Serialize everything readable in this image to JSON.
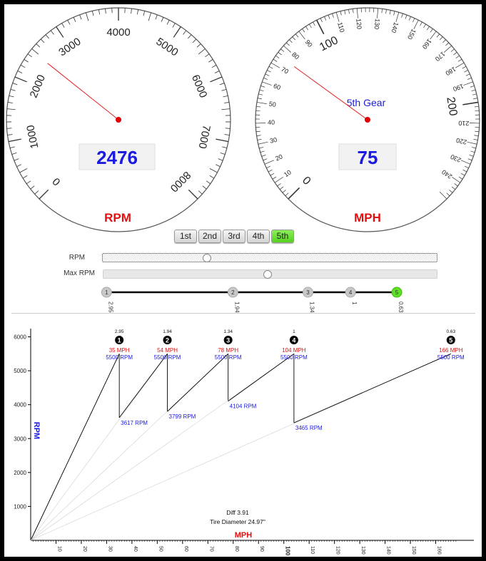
{
  "rpm_gauge": {
    "value": 2476,
    "max": 8000,
    "ticks": [
      "0",
      "1000",
      "2000",
      "3000",
      "4000",
      "5000",
      "6000",
      "7000",
      "8000"
    ],
    "label": "RPM"
  },
  "mph_gauge": {
    "value": 75,
    "max": 250,
    "gear_text": "5th Gear",
    "label": "MPH",
    "major_ticks": [
      "0",
      "100",
      "200"
    ],
    "minor_ticks": [
      "10",
      "20",
      "30",
      "40",
      "50",
      "60",
      "70",
      "80",
      "90",
      "110",
      "120",
      "130",
      "140",
      "150",
      "160",
      "170",
      "180",
      "190",
      "210",
      "220",
      "230",
      "240"
    ]
  },
  "gear_buttons": [
    {
      "label": "1st",
      "active": false
    },
    {
      "label": "2nd",
      "active": false
    },
    {
      "label": "3rd",
      "active": false
    },
    {
      "label": "4th",
      "active": false
    },
    {
      "label": "5th",
      "active": true
    }
  ],
  "sliders": {
    "rpm_label": "RPM",
    "rpm_value": 0.305,
    "max_rpm_label": "Max RPM",
    "max_rpm_value": 0.5
  },
  "gear_ratio_line": {
    "nodes": [
      {
        "label": "1",
        "ratio": "2.95",
        "ratio_num": 2.95,
        "active": false
      },
      {
        "label": "2",
        "ratio": "1.94",
        "ratio_num": 1.94,
        "active": false
      },
      {
        "label": "3",
        "ratio": "1.34",
        "ratio_num": 1.34,
        "active": false
      },
      {
        "label": "4",
        "ratio": "1",
        "ratio_num": 1.0,
        "active": false
      },
      {
        "label": "5",
        "ratio": "0.63",
        "ratio_num": 0.63,
        "active": true
      }
    ]
  },
  "chart_data": {
    "type": "line",
    "ylabel": "RPM",
    "xlabel": "MPH",
    "xlim": [
      0,
      170
    ],
    "ylim": [
      0,
      6200
    ],
    "yticks": [
      "1000",
      "2000",
      "3000",
      "4000",
      "5000",
      "6000"
    ],
    "xticks": [
      "10",
      "20",
      "30",
      "40",
      "50",
      "60",
      "70",
      "80",
      "90",
      "100",
      "110",
      "120",
      "130",
      "140",
      "150",
      "160"
    ],
    "gears": [
      {
        "num": "1",
        "ratio": "2.95",
        "top_mph": 35,
        "top_mph_label": "35 MPH",
        "top_rpm_label": "5500 RPM",
        "drop_rpm": 3617,
        "drop_label": "3617 RPM"
      },
      {
        "num": "2",
        "ratio": "1.94",
        "top_mph": 54,
        "top_mph_label": "54 MPH",
        "top_rpm_label": "5500 RPM",
        "drop_rpm": 3799,
        "drop_label": "3799 RPM"
      },
      {
        "num": "3",
        "ratio": "1.34",
        "top_mph": 78,
        "top_mph_label": "78 MPH",
        "top_rpm_label": "5500 RPM",
        "drop_rpm": 4104,
        "drop_label": "4104 RPM"
      },
      {
        "num": "4",
        "ratio": "1",
        "top_mph": 104,
        "top_mph_label": "104 MPH",
        "top_rpm_label": "5500 RPM",
        "drop_rpm": 3465,
        "drop_label": "3465 RPM"
      },
      {
        "num": "5",
        "ratio": "0.63",
        "top_mph": 166,
        "top_mph_label": "166 MPH",
        "top_rpm_label": "5500 RPM",
        "drop_rpm": null,
        "drop_label": ""
      }
    ],
    "redline_rpm": 5500,
    "diff_label": "Diff 3.91",
    "tire_label": "Tire Diameter 24.97\""
  }
}
